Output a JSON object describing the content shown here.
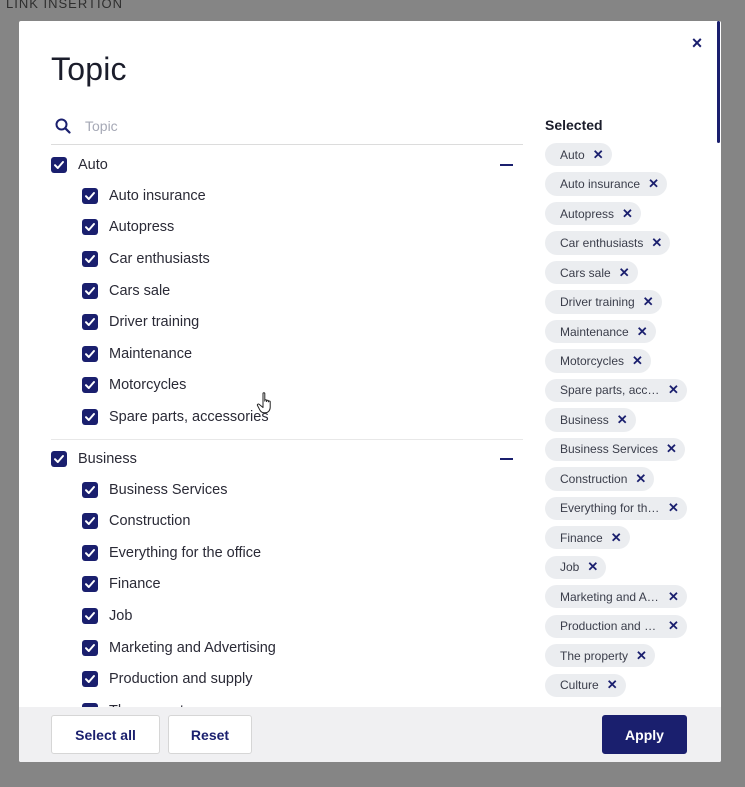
{
  "background": {
    "header": "LINK INSERTION"
  },
  "modal": {
    "title": "Topic",
    "close_icon": "×",
    "search_placeholder": "Topic",
    "groups": [
      {
        "label": "Auto",
        "checked": true,
        "children": [
          "Auto insurance",
          "Autopress",
          "Car enthusiasts",
          "Cars sale",
          "Driver training",
          "Maintenance",
          "Motorcycles",
          "Spare parts, accessories"
        ]
      },
      {
        "label": "Business",
        "checked": true,
        "children": [
          "Business Services",
          "Construction",
          "Everything for the office",
          "Finance",
          "Job",
          "Marketing and Advertising",
          "Production and supply",
          "The property"
        ]
      }
    ],
    "selected_title": "Selected",
    "selected": [
      "Auto",
      "Auto insurance",
      "Autopress",
      "Car enthusiasts",
      "Cars sale",
      "Driver training",
      "Maintenance",
      "Motorcycles",
      "Spare parts, accessories",
      "Business",
      "Business Services",
      "Construction",
      "Everything for the office",
      "Finance",
      "Job",
      "Marketing and Advertising",
      "Production and supply",
      "The property",
      "Culture"
    ],
    "buttons": {
      "select_all": "Select all",
      "reset": "Reset",
      "apply": "Apply"
    }
  },
  "colors": {
    "accent": "#1a1f6e",
    "chip_bg": "#ebedf0"
  }
}
